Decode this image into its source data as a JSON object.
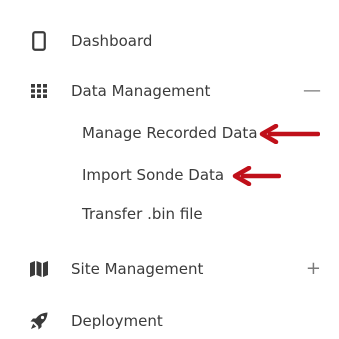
{
  "nav": {
    "dashboard": {
      "label": "Dashboard",
      "icon": "tablet-icon"
    },
    "data_management": {
      "label": "Data Management",
      "icon": "grid-icon",
      "toggle": "—",
      "sub_items": [
        {
          "label": "Manage Recorded Data"
        },
        {
          "label": "Import Sonde Data"
        },
        {
          "label": "Transfer .bin file"
        }
      ]
    },
    "site_management": {
      "label": "Site Management",
      "icon": "map-icon",
      "toggle": "+"
    },
    "deployment": {
      "label": "Deployment",
      "icon": "rocket-icon"
    }
  },
  "colors": {
    "text": "#3b3b3b",
    "icon": "#3a3a3a",
    "annotation_arrow": "#c0101a"
  }
}
